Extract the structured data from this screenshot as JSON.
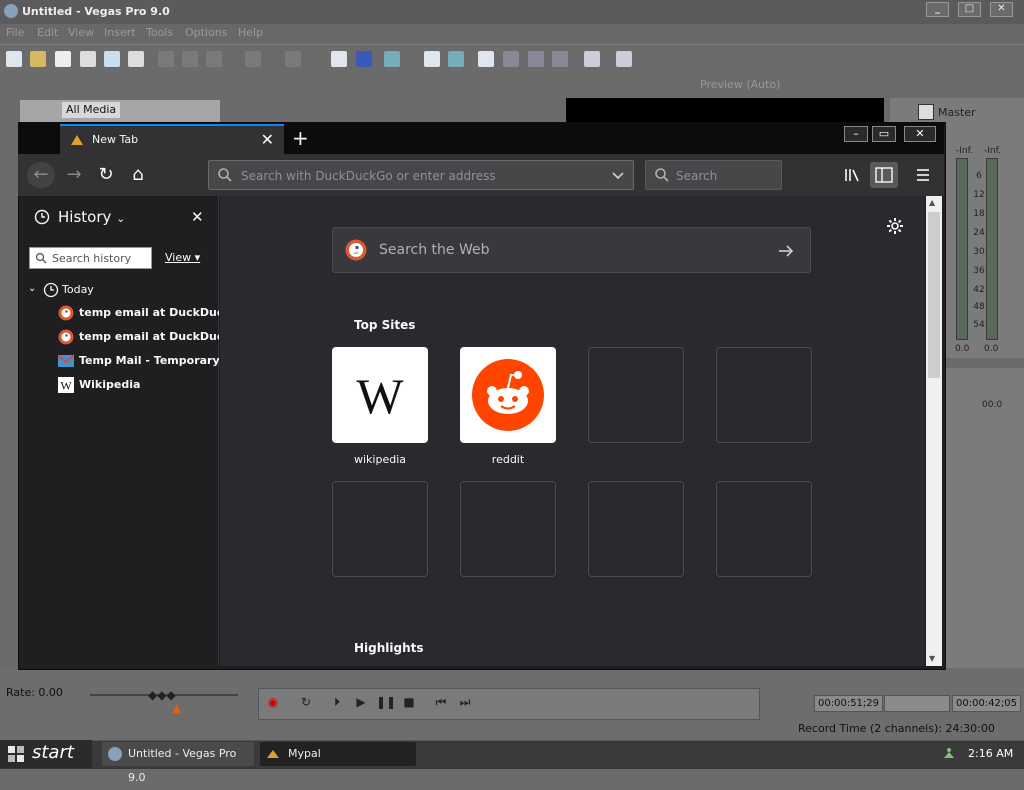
{
  "vegas": {
    "title": "Untitled - Vegas Pro 9.0",
    "menu": [
      "File",
      "Edit",
      "View",
      "Insert",
      "Tools",
      "Options",
      "Help"
    ],
    "media_item": "All Media",
    "preview_label": "Preview (Auto)",
    "master_label": "Master",
    "meter_left_top": "-Inf.",
    "meter_right_top": "-Inf.",
    "meter_scale": [
      "6",
      "12",
      "18",
      "24",
      "30",
      "36",
      "42",
      "48",
      "54"
    ],
    "meter_left_bottom": "0.0",
    "meter_right_bottom": "0.0",
    "ruler_time": "00:0",
    "rate": "Rate: 0.00",
    "time_current": "00:00:51;29",
    "time_end": "00:00:42;05",
    "record_time": "Record Time (2 channels): 24:30:00"
  },
  "taskbar": {
    "start": "start",
    "tasks": [
      "Untitled - Vegas Pro 9.0",
      "Mypal"
    ],
    "clock": "2:16 AM"
  },
  "browser": {
    "tab_title": "New Tab",
    "url_placeholder": "Search with DuckDuckGo or enter address",
    "search_placeholder": "Search",
    "sidebar": {
      "title": "History",
      "search_placeholder": "Search history",
      "view_label": "View",
      "group": "Today",
      "items": [
        {
          "label": "temp email at DuckDuck...",
          "icon": "duckduckgo-icon"
        },
        {
          "label": "temp email at DuckDuck...",
          "icon": "duckduckgo-icon"
        },
        {
          "label": "Temp Mail - Temporary E...",
          "icon": "tempmail-icon"
        },
        {
          "label": "Wikipedia",
          "icon": "wikipedia-icon"
        }
      ]
    },
    "newtab": {
      "search_placeholder": "Search the Web",
      "top_sites_title": "Top Sites",
      "top_sites": [
        {
          "label": "wikipedia",
          "icon": "wikipedia-icon"
        },
        {
          "label": "reddit",
          "icon": "reddit-icon"
        }
      ],
      "highlights_title": "Highlights"
    }
  },
  "colors": {
    "browser_bg": "#2a2a2e",
    "accent": "#0a84ff",
    "reddit": "#ff4500"
  }
}
